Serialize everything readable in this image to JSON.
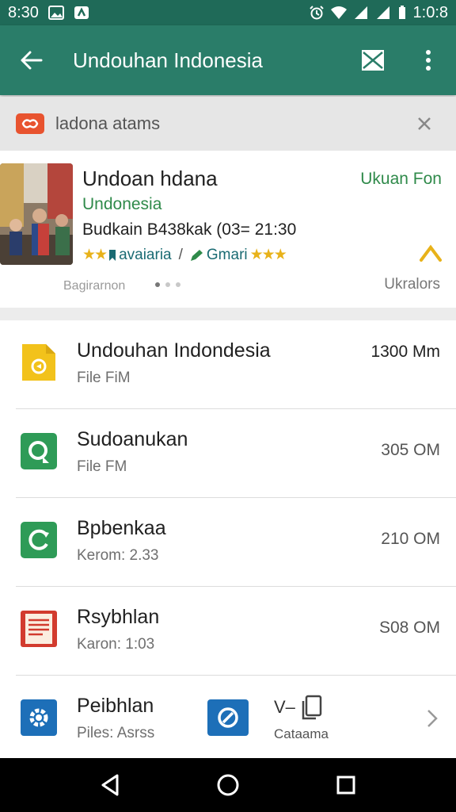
{
  "status_bar": {
    "time_left": "8:30",
    "time_right": "1:0:8"
  },
  "app_bar": {
    "title": "Undouhan Indonesia",
    "icons": [
      "back-arrow-icon",
      "mail-icon",
      "more-vert-icon"
    ]
  },
  "banner": {
    "text": "ladona atams"
  },
  "featured": {
    "title": "Undoan hdana",
    "badge": "Ukuan Fon",
    "subtitle": "Undonesia",
    "meta": "Budkain B438kak (03= 21:30",
    "rating_text_1": "avaiaria",
    "rating_sep": "/",
    "rating_text_2": "Gmari",
    "stars": "★★",
    "stars_2": "★★★",
    "footer_left": "Bagirarnon",
    "footer_right": "Ukralors",
    "page_dots": 3,
    "active_dot": 0
  },
  "list": {
    "items": [
      {
        "title": "Undouhan Indondesia",
        "subtitle": "File FiM",
        "size": "1300 Mm",
        "icon": "yellow-file-icon",
        "color": "#f2c21b"
      },
      {
        "title": "Sudoanukan",
        "subtitle": "File FM",
        "size": "305 OM",
        "icon": "green-app-icon",
        "color": "#2e9b57"
      },
      {
        "title": "Bpbenkaa",
        "subtitle": "Kerom: 2.33",
        "size": "210 OM",
        "icon": "green-refresh-icon",
        "color": "#2e9b57"
      },
      {
        "title": "Rsybhlan",
        "subtitle": "Karon: 1:03",
        "size": "S08 OM",
        "icon": "red-document-icon",
        "color": "#d23b2e"
      }
    ],
    "last": {
      "title": "Peibhlan",
      "subtitle": "Piles: Asrss",
      "mid_label": "V–",
      "mid_sub": "Cataama",
      "icon": "blue-gear-file-icon",
      "icon2": "blue-share-icon",
      "color": "#1d6fb8"
    }
  },
  "nav_bar": {
    "icons": [
      "back-triangle-icon",
      "home-circle-icon",
      "recents-square-icon"
    ]
  }
}
